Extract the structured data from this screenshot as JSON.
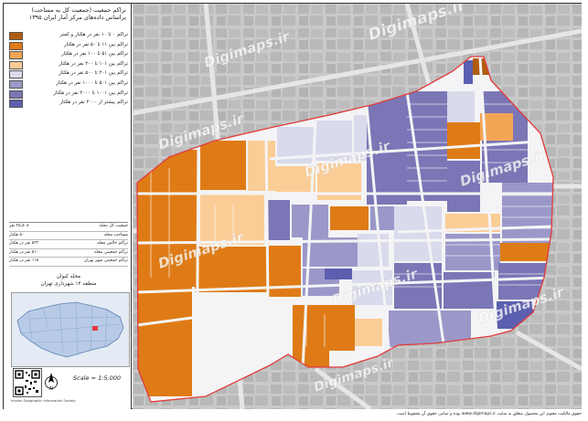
{
  "panel": {
    "title_line1": "نراکم جمعیت (جمعیت کل به مساحت)",
    "title_line2": "براساس داده‌های مرکز آمار ایران ۱۳۹۵"
  },
  "legend": [
    {
      "label": "تراکم ۰ تا ۱۰ نفر در هکتار و کمتر",
      "color": "#b15c12"
    },
    {
      "label": "تراکم بین ۱۱ تا ۵۰ نفر در هکتار",
      "color": "#df7b16"
    },
    {
      "label": "تراکم بین ۵۱ تا ۱۰۰ نفر در هکتار",
      "color": "#f3a556"
    },
    {
      "label": "تراکم بین ۱۰۱ تا ۲۰۰ نفر در هکتار",
      "color": "#fbcd96"
    },
    {
      "label": "تراکم بین ۲۰۱ تا ۵۰۰ نفر در هکتار",
      "color": "#d9daeb"
    },
    {
      "label": "تراکم بین ۵۰۱ تا ۱۰۰۰ نفر در هکتار",
      "color": "#9b98c9"
    },
    {
      "label": "تراکم بین ۱۰۰۱ تا ۲۰۰۰ نفر در هکتار",
      "color": "#7b76b6"
    },
    {
      "label": "تراکم بیشتر از ۲۰۰۰ نفر در هکتار",
      "color": "#5c5fb0"
    }
  ],
  "stats": [
    {
      "label": "جمعیت کل محله",
      "value": "۲۵,۸۰۸ نفر"
    },
    {
      "label": "مساحت محله",
      "value": "۵۰ هکتار"
    },
    {
      "label": "تراکم خالص محله",
      "value": "۵۲۲ نفر در هکتار"
    },
    {
      "label": "تراکم جمعیتی محله",
      "value": "۵۱۰ نفر در هکتار"
    },
    {
      "label": "تراکم جمعیتی شهر تهران",
      "value": "۱۱۵ نفر در هکتار"
    }
  ],
  "location": {
    "line1": "محله کیوان",
    "line2": "منطقه ۱۴ شهرداری تهران"
  },
  "scale_text": "Scale = 1:5,000",
  "credit": "Iranian Geographic Information Society",
  "footer": "حقوق مالکیت معنوی این محصول متعلق به سایت www.digimaps.ir بوده و تمامی حقوق آن محفوظ است.",
  "watermark": "Digimaps.ir",
  "colors": {
    "orange_dark": "#b15c12",
    "orange": "#df7b16",
    "orange_mid": "#f3a556",
    "orange_light": "#fbcd96",
    "purple_pale": "#d9daeb",
    "purple_light": "#9b98c9",
    "purple": "#7b76b6",
    "purple_dark": "#5c5fb0",
    "boundary": "#e23b3b"
  }
}
